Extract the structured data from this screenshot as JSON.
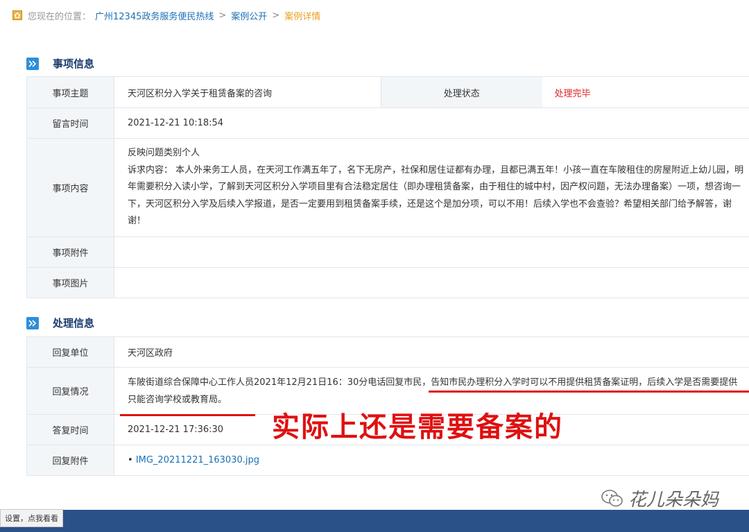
{
  "breadcrumb": {
    "prefix": "您现在的位置：",
    "items": [
      "广州12345政务服务便民热线",
      "案例公开",
      "案例详情"
    ],
    "separator": ">"
  },
  "sections": {
    "item_info": {
      "title": "事项信息",
      "rows": {
        "subject_label": "事项主题",
        "subject_value": "天河区积分入学关于租赁备案的咨询",
        "status_label": "处理状态",
        "status_value": "处理完毕",
        "time_label": "留言时间",
        "time_value": "2021-12-21 10:18:54",
        "content_label": "事项内容",
        "content_line1": "反映问题类别个人",
        "content_line2": "诉求内容： 本人外来务工人员，在天河工作满五年了，名下无房产，社保和居住证都有办理，且都已满五年！小孩一直在车陂租住的房屋附近上幼儿园，明年需要积分入读小学，了解到天河区积分入学项目里有合法稳定居住（即办理租赁备案，由于租住的城中村，因产权问题，无法办理备案）一项，想咨询一下，天河区积分入学及后续入学报道，是否一定要用到租赁备案手续，还是这个是加分项，可以不用！后续入学也不会查验？希望相关部门给予解答，谢谢！",
        "attachment_label": "事项附件",
        "image_label": "事项图片"
      }
    },
    "handling_info": {
      "title": "处理信息",
      "rows": {
        "unit_label": "回复单位",
        "unit_value": "天河区政府",
        "reply_label": "回复情况",
        "reply_value": "车陂街道综合保障中心工作人员2021年12月21日16：30分电话回复市民，告知市民办理积分入学时可以不用提供租赁备案证明，后续入学是否需要提供只能咨询学校或教育局。",
        "answer_time_label": "答复时间",
        "answer_time_value": "2021-12-21 17:36:30",
        "reply_attachment_label": "回复附件",
        "reply_attachment_bullet": "•",
        "reply_attachment_file": "IMG_20211221_163030.jpg"
      }
    }
  },
  "annotation": {
    "note": "实际上还是需要备案的",
    "color": "#e01010"
  },
  "watermark": {
    "text": "花儿朵朵妈",
    "icon": "wechat-icon"
  },
  "tip": {
    "text": "设置，点我看看"
  },
  "colors": {
    "accent": "#2f8ed9",
    "link": "#1a6fb5",
    "status": "#e02424",
    "footer": "#2b5189",
    "current_crumb": "#e8a020"
  }
}
